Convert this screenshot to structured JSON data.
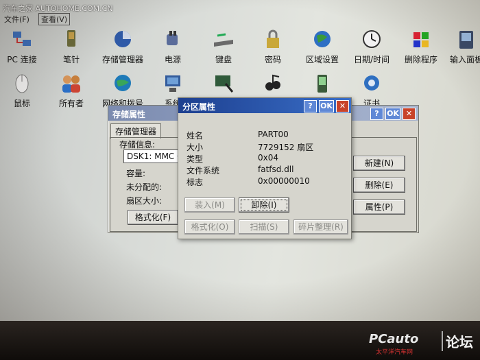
{
  "watermark": "汽车之家 AUTOHOME.COM.CN",
  "menu": {
    "file": "文件(F)",
    "view": "查看(V)"
  },
  "icons_row1": [
    {
      "label": "PC 连接",
      "icon": "pc-connection-icon"
    },
    {
      "label": "笔针",
      "icon": "stylus-icon"
    },
    {
      "label": "存储管理器",
      "icon": "storage-manager-icon"
    },
    {
      "label": "电源",
      "icon": "power-icon"
    },
    {
      "label": "键盘",
      "icon": "keyboard-icon"
    },
    {
      "label": "密码",
      "icon": "password-lock-icon"
    },
    {
      "label": "区域设置",
      "icon": "regional-settings-icon"
    },
    {
      "label": "日期/时间",
      "icon": "date-time-icon"
    },
    {
      "label": "删除程序",
      "icon": "remove-programs-icon"
    },
    {
      "label": "输入面板",
      "icon": "input-panel-icon"
    }
  ],
  "icons_row2": [
    {
      "label": "鼠标",
      "icon": "mouse-icon"
    },
    {
      "label": "所有者",
      "icon": "owner-icon"
    },
    {
      "label": "网络和拨号",
      "icon": "network-dialup-icon"
    },
    {
      "label": "系统",
      "icon": "system-icon"
    },
    {
      "label": "",
      "icon": "display-icon"
    },
    {
      "label": "",
      "icon": "sounds-icon"
    },
    {
      "label": "",
      "icon": "pda-icon"
    },
    {
      "label": "证书",
      "icon": "certificates-icon"
    }
  ],
  "storage_window": {
    "title": "存储属性",
    "tab": "存储管理器",
    "storage_info_label": "存储信息:",
    "device_value": "DSK1: MMC C",
    "capacity_label": "容量:",
    "unallocated_label": "未分配的:",
    "sector_size_label": "扇区大小:",
    "format_button": "格式化(F)",
    "new_button": "新建(N)",
    "delete_button": "删除(E)",
    "properties_button": "属性(P)",
    "help_glyph": "?",
    "ok_label": "OK",
    "close_glyph": "✕"
  },
  "partition_dialog": {
    "title": "分区属性",
    "help_glyph": "?",
    "ok_label": "OK",
    "close_glyph": "✕",
    "fields": [
      {
        "label": "姓名",
        "value": "PART00"
      },
      {
        "label": "大小",
        "value": "7729152 扇区"
      },
      {
        "label": "类型",
        "value": "0x04"
      },
      {
        "label": "文件系统",
        "value": "fatfsd.dll"
      },
      {
        "label": "标志",
        "value": "0x00000010"
      }
    ],
    "buttons": {
      "mount": "装入(M)",
      "unmount": "卸除(I)",
      "format": "格式化(O)",
      "scan": "扫描(S)",
      "defrag": "碎片整理(R)"
    }
  },
  "bottom_logo": {
    "brand": "PCauto",
    "subtitle": "太平洋汽车网",
    "forum": "论坛"
  }
}
